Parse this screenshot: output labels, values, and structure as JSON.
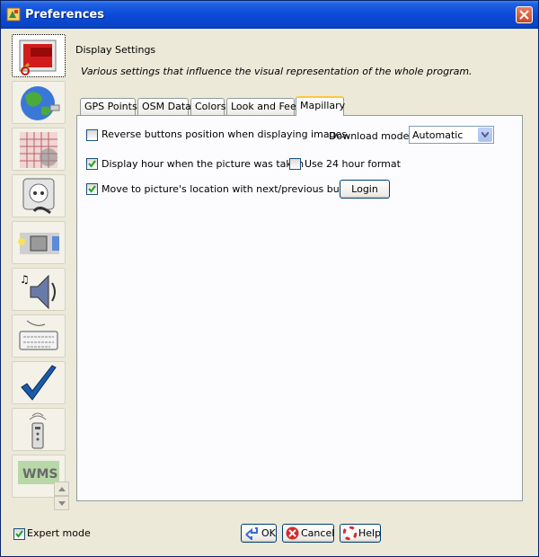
{
  "window": {
    "title": "Preferences"
  },
  "sidebar": {
    "items": [
      {
        "name": "display-settings",
        "icon": "paint-roller-icon",
        "selected": true
      },
      {
        "name": "connection-settings",
        "icon": "globe-icon"
      },
      {
        "name": "projection-settings",
        "icon": "map-grid-icon"
      },
      {
        "name": "plugin-settings",
        "icon": "power-plug-icon"
      },
      {
        "name": "advanced-settings",
        "icon": "files-icon"
      },
      {
        "name": "audio-settings",
        "icon": "speaker-icon"
      },
      {
        "name": "shortcut-settings",
        "icon": "keyboard-icon"
      },
      {
        "name": "validator-settings",
        "icon": "checkmark-icon"
      },
      {
        "name": "remote-control-settings",
        "icon": "remote-control-icon"
      },
      {
        "name": "wms-settings",
        "icon": "wms-icon",
        "label": "WMS"
      }
    ]
  },
  "section": {
    "title": "Display Settings",
    "description": "Various settings that influence the visual representation of the whole program."
  },
  "tabs": [
    "GPS Points",
    "OSM Data",
    "Colors",
    "Look and Feel",
    "Mapillary"
  ],
  "active_tab": "Mapillary",
  "mapillary": {
    "reverse_buttons": {
      "label": "Reverse buttons position when displaying images.",
      "checked": false
    },
    "download_mode_label": "Download mode:",
    "download_mode_value": "Automatic",
    "display_hour": {
      "label": "Display hour when the picture was taken",
      "checked": true
    },
    "format24": {
      "label": "Use 24 hour format",
      "checked": false
    },
    "move_to_location": {
      "label": "Move to picture's location with next/previous buttons",
      "checked": true
    },
    "login_label": "Login"
  },
  "footer": {
    "expert_mode": {
      "label": "Expert mode",
      "checked": true
    },
    "ok_label": "OK",
    "cancel_label": "Cancel",
    "help_label": "Help"
  },
  "colors": {
    "title_bar": "#0a4ad8",
    "tab_highlight": "#ffc83c",
    "check": "#21a121"
  }
}
